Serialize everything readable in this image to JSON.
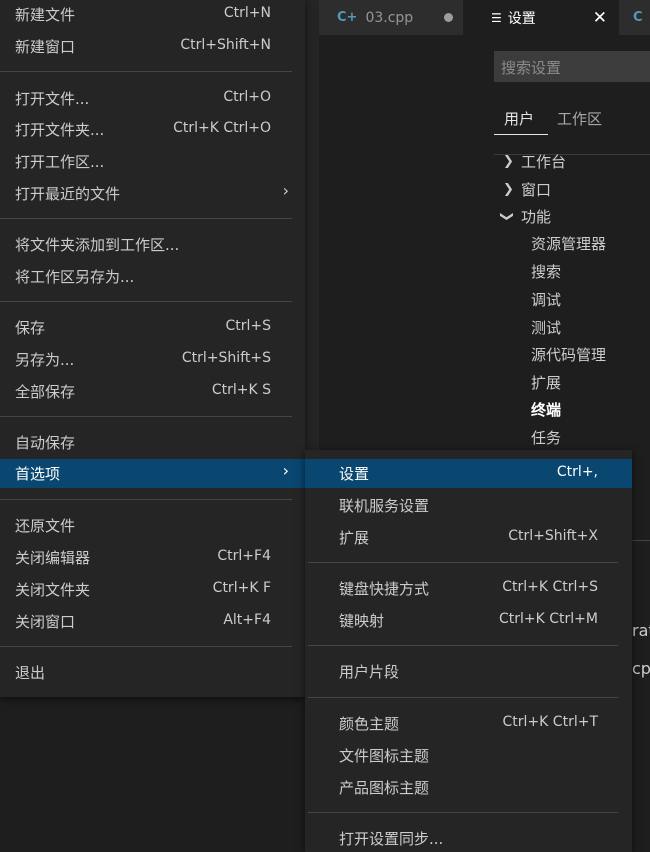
{
  "tabs": [
    {
      "name": "03.cpp",
      "icon": "cpp-file-icon",
      "modified": true
    },
    {
      "name": "设置",
      "icon": "settings-list-icon",
      "close": "✕"
    }
  ],
  "settings": {
    "search_placeholder": "搜索设置",
    "scope_tabs": [
      "用户",
      "工作区"
    ],
    "tree": {
      "groups": [
        "工作台",
        "窗口",
        "功能"
      ],
      "features": [
        "资源管理器",
        "搜索",
        "调试",
        "测试",
        "源代码管理",
        "扩展",
        "终端",
        "任务"
      ]
    },
    "partial_text": [
      "rat",
      "cps"
    ]
  },
  "file_menu": {
    "items": [
      {
        "label": "新建文件",
        "shortcut": "Ctrl+N"
      },
      {
        "label": "新建窗口",
        "shortcut": "Ctrl+Shift+N"
      },
      {
        "label": "打开文件...",
        "shortcut": "Ctrl+O"
      },
      {
        "label": "打开文件夹...",
        "shortcut": "Ctrl+K Ctrl+O"
      },
      {
        "label": "打开工作区...",
        "shortcut": ""
      },
      {
        "label": "打开最近的文件",
        "submenu": "›"
      },
      {
        "label": "将文件夹添加到工作区...",
        "shortcut": ""
      },
      {
        "label": "将工作区另存为...",
        "shortcut": ""
      },
      {
        "label": "保存",
        "shortcut": "Ctrl+S"
      },
      {
        "label": "另存为...",
        "shortcut": "Ctrl+Shift+S"
      },
      {
        "label": "全部保存",
        "shortcut": "Ctrl+K S"
      },
      {
        "label": "自动保存",
        "shortcut": ""
      },
      {
        "label": "首选项",
        "submenu": "›"
      },
      {
        "label": "还原文件",
        "shortcut": ""
      },
      {
        "label": "关闭编辑器",
        "shortcut": "Ctrl+F4"
      },
      {
        "label": "关闭文件夹",
        "shortcut": "Ctrl+K F"
      },
      {
        "label": "关闭窗口",
        "shortcut": "Alt+F4"
      },
      {
        "label": "退出",
        "shortcut": ""
      }
    ]
  },
  "pref_menu": {
    "items": [
      {
        "label": "设置",
        "shortcut": "Ctrl+,"
      },
      {
        "label": "联机服务设置",
        "shortcut": ""
      },
      {
        "label": "扩展",
        "shortcut": "Ctrl+Shift+X"
      },
      {
        "label": "键盘快捷方式",
        "shortcut": "Ctrl+K Ctrl+S"
      },
      {
        "label": "键映射",
        "shortcut": "Ctrl+K Ctrl+M"
      },
      {
        "label": "用户片段",
        "shortcut": ""
      },
      {
        "label": "颜色主题",
        "shortcut": "Ctrl+K Ctrl+T"
      },
      {
        "label": "文件图标主题",
        "shortcut": ""
      },
      {
        "label": "产品图标主题",
        "shortcut": ""
      },
      {
        "label": "打开设置同步...",
        "shortcut": ""
      }
    ]
  },
  "colors": {
    "highlight": "#094771",
    "menu_bg": "#252526"
  }
}
